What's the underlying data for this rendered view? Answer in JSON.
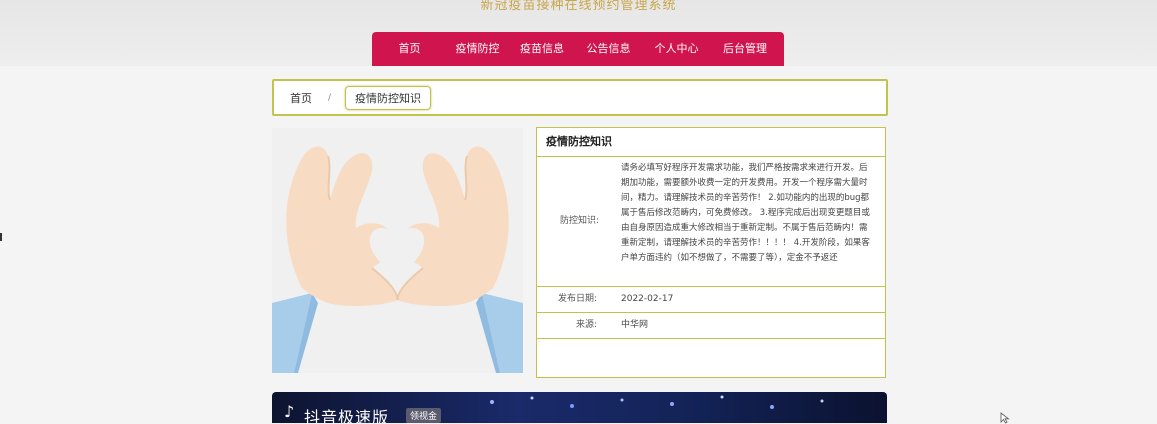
{
  "header": {
    "site_title": "新冠疫苗接种在线预约管理系统"
  },
  "nav": {
    "items": [
      {
        "label": "首页"
      },
      {
        "label": "疫情防控"
      },
      {
        "label": "疫苗信息"
      },
      {
        "label": "公告信息"
      },
      {
        "label": "个人中心"
      },
      {
        "label": "后台管理"
      }
    ]
  },
  "breadcrumb": {
    "home": "首页",
    "separator": "/",
    "current": "疫情防控知识"
  },
  "detail": {
    "title": "疫情防控知识",
    "content_label": "防控知识:",
    "content_text": "请务必填写好程序开发需求功能，我们严格按需求来进行开发。后期加功能，需要额外收费一定的开发费用。开发一个程序需大量时间，精力。请理解技术员的辛苦劳作！ 2.如功能内的出现的bug都属于售后修改范畴内，可免费修改。 3.程序完成后出现变更题目或由自身原因造成重大修改相当于重新定制。不属于售后范畴内！需重新定制，请理解技术员的辛苦劳作！！！！ 4.开发阶段，如果客户单方面违约（如不想做了，不需要了等），定金不予返还",
    "date_label": "发布日期:",
    "date_value": "2022-02-17",
    "source_label": "来源:",
    "source_value": "中华网"
  },
  "banner": {
    "text": "抖音极速版",
    "badge": "领视金"
  },
  "colors": {
    "nav_bg": "#d0154e",
    "accent_border": "#c3c24f",
    "title_gold": "#c9a64a"
  }
}
